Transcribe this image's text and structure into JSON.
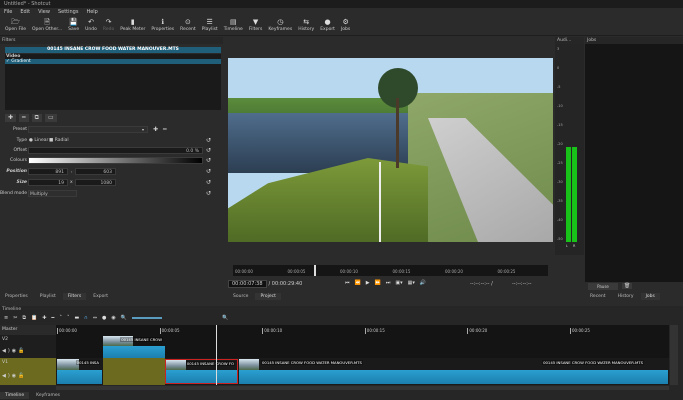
{
  "window": {
    "title": "Untitled* - Shotcut"
  },
  "menu": [
    "File",
    "Edit",
    "View",
    "Settings",
    "Help"
  ],
  "toolbar": [
    {
      "label": "Open File",
      "icon": "folder-icon"
    },
    {
      "label": "Open Other...",
      "icon": "open-other-icon"
    },
    {
      "label": "Save",
      "icon": "save-icon"
    },
    {
      "label": "Undo",
      "icon": "undo-icon"
    },
    {
      "label": "Redo",
      "icon": "redo-icon",
      "disabled": true
    },
    {
      "label": "Peak Meter",
      "icon": "peak-meter-icon"
    },
    {
      "label": "Properties",
      "icon": "info-icon"
    },
    {
      "label": "Recent",
      "icon": "recent-icon"
    },
    {
      "label": "Playlist",
      "icon": "playlist-icon"
    },
    {
      "label": "Timeline",
      "icon": "timeline-icon"
    },
    {
      "label": "Filters",
      "icon": "filter-icon"
    },
    {
      "label": "Keyframes",
      "icon": "keyframes-icon"
    },
    {
      "label": "History",
      "icon": "history-icon"
    },
    {
      "label": "Export",
      "icon": "export-icon"
    },
    {
      "label": "Jobs",
      "icon": "jobs-icon"
    }
  ],
  "filters": {
    "title": "Filters",
    "clip_name": "00145 INSANE CROW FOOD WATER MANOUVER.MTS",
    "group": "Video",
    "items": [
      {
        "label": "Gradient",
        "checked": true
      }
    ],
    "preset_label": "Preset",
    "preset_value": "",
    "type_label": "Type",
    "type_options": [
      "Linear",
      "Radial"
    ],
    "type_selected": "Linear",
    "offset_label": "Offset",
    "offset_value": "0.0 %",
    "colours_label": "Colours",
    "position_label": "Position",
    "position_x": "891",
    "position_y": "603",
    "position_sep": ",",
    "size_label": "Size",
    "size_w": "19",
    "size_h": "1080",
    "size_sep": "x",
    "blend_label": "Blend mode",
    "blend_value": "Multiply"
  },
  "left_tabs": [
    "Properties",
    "Playlist",
    "Filters",
    "Export"
  ],
  "player": {
    "ruler": [
      "00:00:00",
      "00:00:05",
      "00:00:10",
      "00:00:15",
      "00:00:20",
      "00:00:25"
    ],
    "position": "00:00:07:38",
    "duration": "/ 00:00:29:40",
    "in_point": "--:--:--:-- /",
    "out_point": "--:--:--:--",
    "tabs": [
      "Source",
      "Project"
    ],
    "active_tab": "Project"
  },
  "audio": {
    "title": "Audi...",
    "scale": [
      "3",
      "0",
      "-5",
      "-10",
      "-15",
      "-20",
      "-25",
      "-30",
      "-35",
      "-40",
      "-50"
    ],
    "channels": [
      "L",
      "R"
    ],
    "level_db": -19
  },
  "jobs": {
    "title": "Jobs",
    "pause": "Pause",
    "tabs": [
      "Recent",
      "History",
      "Jobs"
    ]
  },
  "timeline": {
    "title": "Timeline",
    "master": "Master",
    "ruler": [
      "00:00:00",
      "00:00:05",
      "00:00:10",
      "00:00:15",
      "00:00:20",
      "00:00:25"
    ],
    "tracks": [
      {
        "name": "V2",
        "clips": [
          {
            "label": "00145 INSANE CROW"
          }
        ]
      },
      {
        "name": "V1",
        "clips": [
          {
            "label": "00145 INSA"
          },
          {
            "label": "00145 INSANE CROW FO"
          },
          {
            "label": "00145 INSANE CROW FOOD WATER MANOUVER.MTS"
          },
          {
            "label": "00145 INSANE CROW FOOD WATER MANOUVER.MTS"
          }
        ]
      }
    ],
    "bottom_tabs": [
      "Timeline",
      "Keyframes"
    ]
  }
}
